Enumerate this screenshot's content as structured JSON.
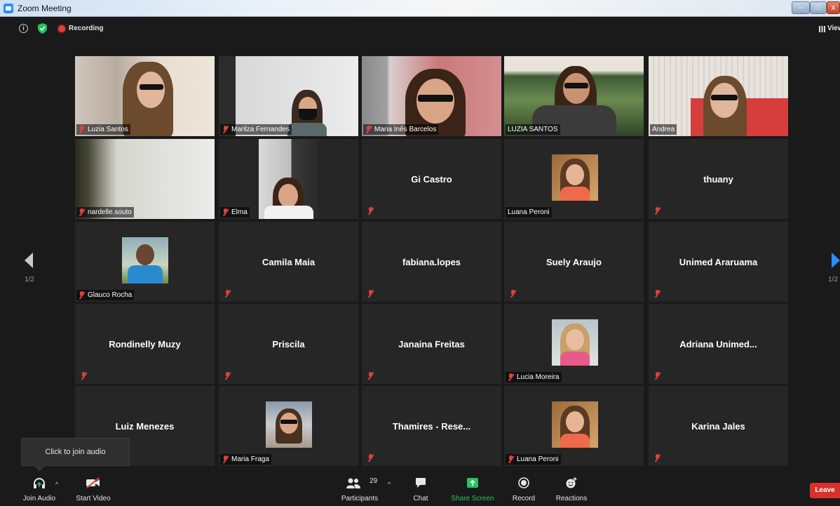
{
  "window": {
    "title": "Zoom Meeting"
  },
  "topbar": {
    "recording_label": "Recording",
    "view_label": "View"
  },
  "navigation": {
    "page_left": "1/2",
    "page_right": "1/2"
  },
  "participants": [
    {
      "name": "Luzia Santos",
      "video": true,
      "muted": true
    },
    {
      "name": "Marilza Fernandes",
      "video": true,
      "muted": true
    },
    {
      "name": "Maria Inês Barcelos",
      "video": true,
      "muted": true
    },
    {
      "name": "LUZIA SANTOS",
      "video": true,
      "muted": false,
      "active_speaker": true
    },
    {
      "name": "Andrea",
      "video": true,
      "muted": false
    },
    {
      "name": "nardelle.souto",
      "video": true,
      "muted": true
    },
    {
      "name": "Elma",
      "video": true,
      "muted": true
    },
    {
      "name": "Gi Castro",
      "video": false,
      "muted": true
    },
    {
      "name": "Luana Peroni",
      "video": false,
      "photo": true,
      "muted": false
    },
    {
      "name": "thuany",
      "video": false,
      "muted": true
    },
    {
      "name": "Glauco Rocha",
      "video": false,
      "photo": true,
      "muted": true
    },
    {
      "name": "Camila Maia",
      "video": false,
      "muted": true
    },
    {
      "name": "fabiana.lopes",
      "video": false,
      "muted": true
    },
    {
      "name": "Suely Araujo",
      "video": false,
      "muted": true
    },
    {
      "name": "Unimed Araruama",
      "video": false,
      "muted": true
    },
    {
      "name": "Rondinelly Muzy",
      "video": false,
      "muted": true
    },
    {
      "name": "Priscila",
      "video": false,
      "muted": true
    },
    {
      "name": "Janaina Freitas",
      "video": false,
      "muted": true
    },
    {
      "name": "Lucia Moreira",
      "video": false,
      "photo": true,
      "muted": true
    },
    {
      "name": "Adriana  Unimed...",
      "video": false,
      "muted": true
    },
    {
      "name": "Luiz Menezes",
      "video": false,
      "muted": true
    },
    {
      "name": "Maria Fraga",
      "video": false,
      "photo": true,
      "muted": true
    },
    {
      "name": "Thamires - Rese...",
      "video": false,
      "muted": true
    },
    {
      "name": "Luana Peroni",
      "video": false,
      "photo": true,
      "muted": true
    },
    {
      "name": "Karina Jales",
      "video": false,
      "muted": true
    }
  ],
  "tooltip": {
    "text": "Click to join audio"
  },
  "toolbar": {
    "join_audio": "Join Audio",
    "start_video": "Start Video",
    "participants": "Participants",
    "participants_count": "29",
    "chat": "Chat",
    "share_screen": "Share Screen",
    "record": "Record",
    "reactions": "Reactions",
    "leave": "Leave"
  },
  "colors": {
    "accent": "#2d8cff",
    "share_green": "#22c55e",
    "leave_red": "#d9302a",
    "active_border": "#b9d86a",
    "muted_red": "#e0413a"
  }
}
